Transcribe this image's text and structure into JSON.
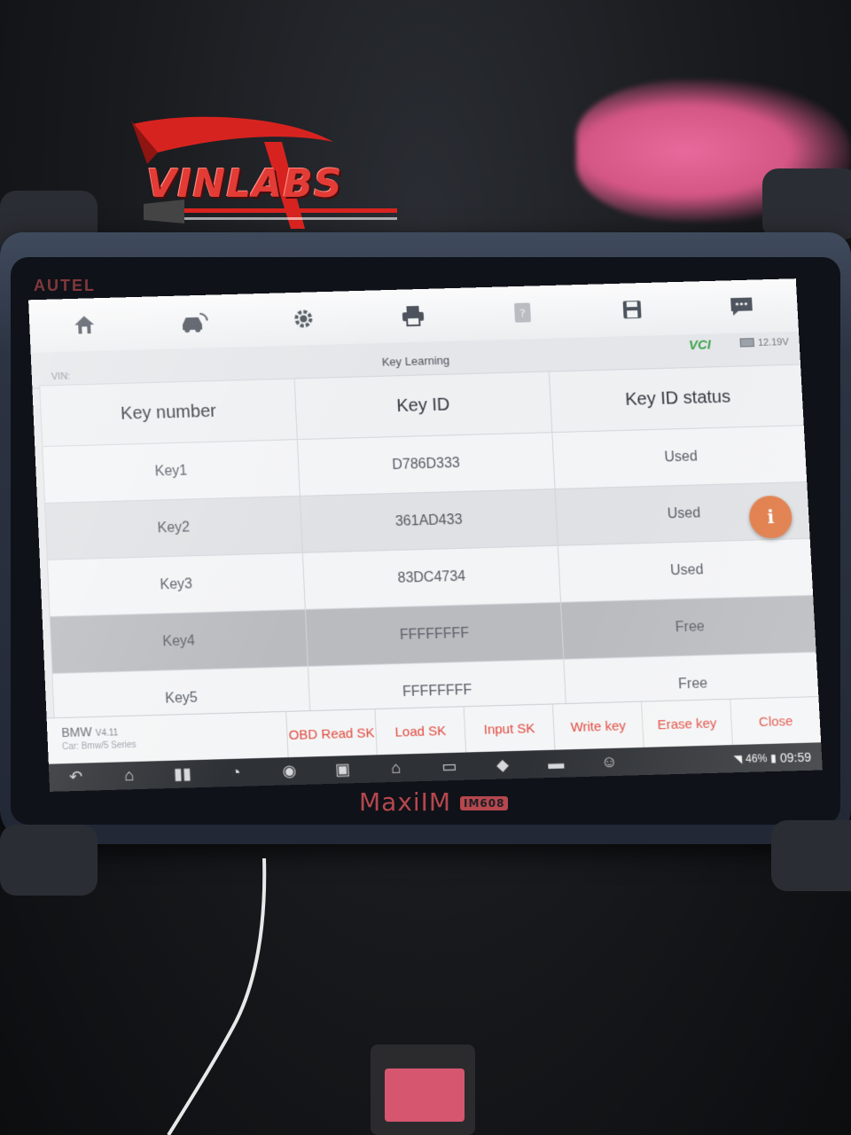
{
  "watermark": {
    "logo_text": "VINLABS"
  },
  "device": {
    "brand": "AUTEL",
    "model_name": "MaxiIM",
    "model_badge": "IM608"
  },
  "toolbar": {
    "icons": [
      "home-icon",
      "car-switch-icon",
      "settings-icon",
      "print-icon",
      "help-icon",
      "save-icon",
      "message-icon"
    ]
  },
  "header": {
    "vin_label": "VIN:",
    "title": "Key Learning",
    "vci_label": "VCI",
    "voltage": "12.19V"
  },
  "table": {
    "columns": [
      "Key number",
      "Key ID",
      "Key ID status"
    ],
    "rows": [
      {
        "key": "Key1",
        "id": "D786D333",
        "status": "Used"
      },
      {
        "key": "Key2",
        "id": "361AD433",
        "status": "Used"
      },
      {
        "key": "Key3",
        "id": "83DC4734",
        "status": "Used"
      },
      {
        "key": "Key4",
        "id": "FFFFFFFF",
        "status": "Free"
      },
      {
        "key": "Key5",
        "id": "FFFFFFFF",
        "status": "Free"
      }
    ],
    "selected_row": 3
  },
  "vehicle": {
    "make": "BMW",
    "version": "V4.11",
    "car": "Car: Bmw/5 Series"
  },
  "actions": [
    "OBD Read SK",
    "Load SK",
    "Input SK",
    "Write key",
    "Erase key",
    "Close"
  ],
  "android_nav": {
    "icons": [
      "back-icon",
      "home-icon",
      "recents-icon",
      "browser-icon",
      "camera-icon",
      "gallery-icon",
      "shop-icon",
      "vci-icon",
      "car-check-icon",
      "car-icon",
      "user-car-icon"
    ]
  },
  "status_bar": {
    "battery": "46%",
    "time": "09:59"
  },
  "colors": {
    "action_text": "#e04a3f",
    "info_button": "#e07a46",
    "brand_red": "#b5474d"
  }
}
